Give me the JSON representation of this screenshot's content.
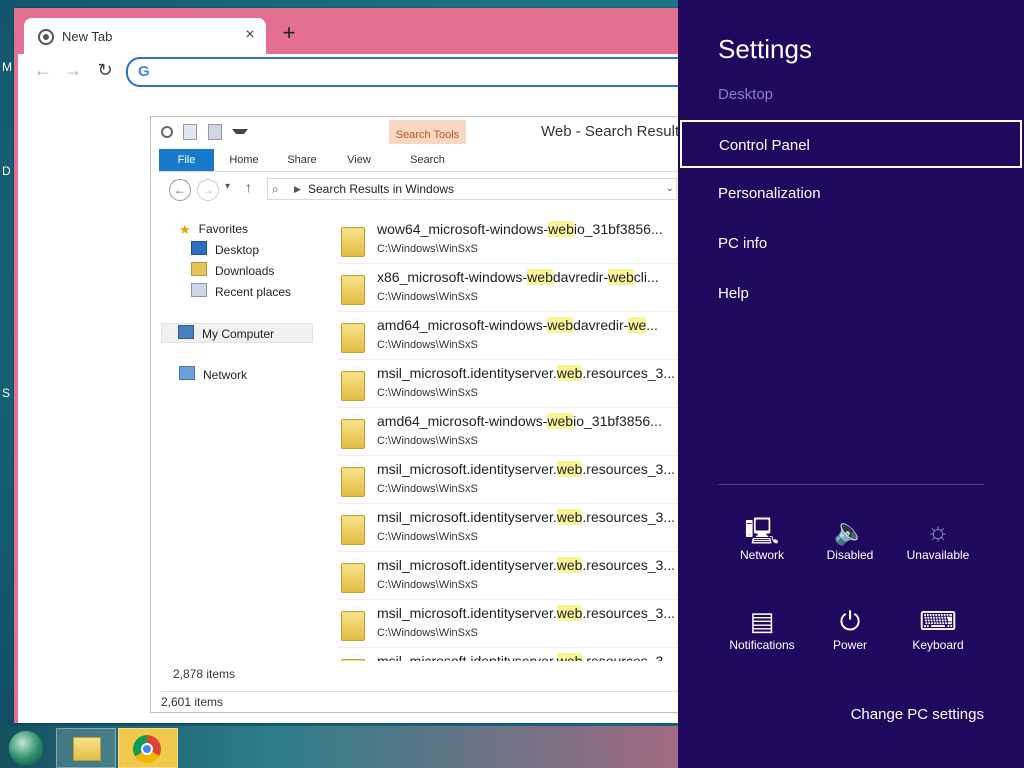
{
  "chrome": {
    "tab_title": "New Tab",
    "tab_close": "×",
    "new_tab": "+",
    "back": "←",
    "forward": "→",
    "reload": "↻",
    "omnibox_value": "",
    "google_glyph": "G"
  },
  "explorer": {
    "title": "Web - Search Results",
    "search_tools_label": "Search Tools",
    "ribbon_tabs": [
      "File",
      "Home",
      "Share",
      "View",
      "Search"
    ],
    "address": "Search Results in Windows",
    "nav": {
      "favorites": "Favorites",
      "desktop": "Desktop",
      "downloads": "Downloads",
      "recent": "Recent places",
      "computer": "My Computer",
      "network": "Network"
    },
    "files": [
      {
        "pre": "wow64_microsoft-windows-",
        "hl": "web",
        "post": "io_31bf3856...",
        "path": "C:\\Windows\\WinSxS"
      },
      {
        "pre": "x86_microsoft-windows-",
        "hl": "web",
        "post": "davredir-",
        "hl2": "web",
        "post2": "cli...",
        "path": "C:\\Windows\\WinSxS"
      },
      {
        "pre": "amd64_microsoft-windows-",
        "hl": "web",
        "post": "davredir-",
        "hl2": "we",
        "post2": "...",
        "path": "C:\\Windows\\WinSxS"
      },
      {
        "pre": "msil_microsoft.identityserver.",
        "hl": "web",
        "post": ".resources_3...",
        "path": "C:\\Windows\\WinSxS"
      },
      {
        "pre": "amd64_microsoft-windows-",
        "hl": "web",
        "post": "io_31bf3856...",
        "path": "C:\\Windows\\WinSxS"
      },
      {
        "pre": "msil_microsoft.identityserver.",
        "hl": "web",
        "post": ".resources_3...",
        "path": "C:\\Windows\\WinSxS"
      },
      {
        "pre": "msil_microsoft.identityserver.",
        "hl": "web",
        "post": ".resources_3...",
        "path": "C:\\Windows\\WinSxS"
      },
      {
        "pre": "msil_microsoft.identityserver.",
        "hl": "web",
        "post": ".resources_3...",
        "path": "C:\\Windows\\WinSxS"
      },
      {
        "pre": "msil_microsoft.identityserver.",
        "hl": "web",
        "post": ".resources_3...",
        "path": "C:\\Windows\\WinSxS"
      },
      {
        "pre": "msil_microsoft.identityserver.",
        "hl": "web",
        "post": ".resources_3...",
        "path": ""
      }
    ],
    "inner_count": "2,878 items",
    "outer_count": "2,601 items"
  },
  "settings": {
    "title": "Settings",
    "subtitle": "Desktop",
    "links": [
      "Control Panel",
      "Personalization",
      "PC info",
      "Help"
    ],
    "tiles": [
      {
        "label": "Network",
        "icon": "network-icon",
        "glyph": "🖳",
        "dim": false
      },
      {
        "label": "Disabled",
        "icon": "speaker-icon",
        "glyph": "🔈",
        "dim": true
      },
      {
        "label": "Unavailable",
        "icon": "brightness-icon",
        "glyph": "☼",
        "dim": true
      },
      {
        "label": "Notifications",
        "icon": "notifications-icon",
        "glyph": "▤",
        "dim": false
      },
      {
        "label": "Power",
        "icon": "power-icon",
        "glyph": "⏻",
        "dim": false
      },
      {
        "label": "Keyboard",
        "icon": "keyboard-icon",
        "glyph": "⌨",
        "dim": false
      }
    ],
    "change_pc": "Change PC settings"
  },
  "desktop": {
    "glyphs": [
      "M",
      "D",
      "S"
    ]
  },
  "colors": {
    "settings_bg": "#20085f",
    "chrome_frame": "#e36f93",
    "file_tab": "#1979ca",
    "highlight": "#fbf59a"
  }
}
